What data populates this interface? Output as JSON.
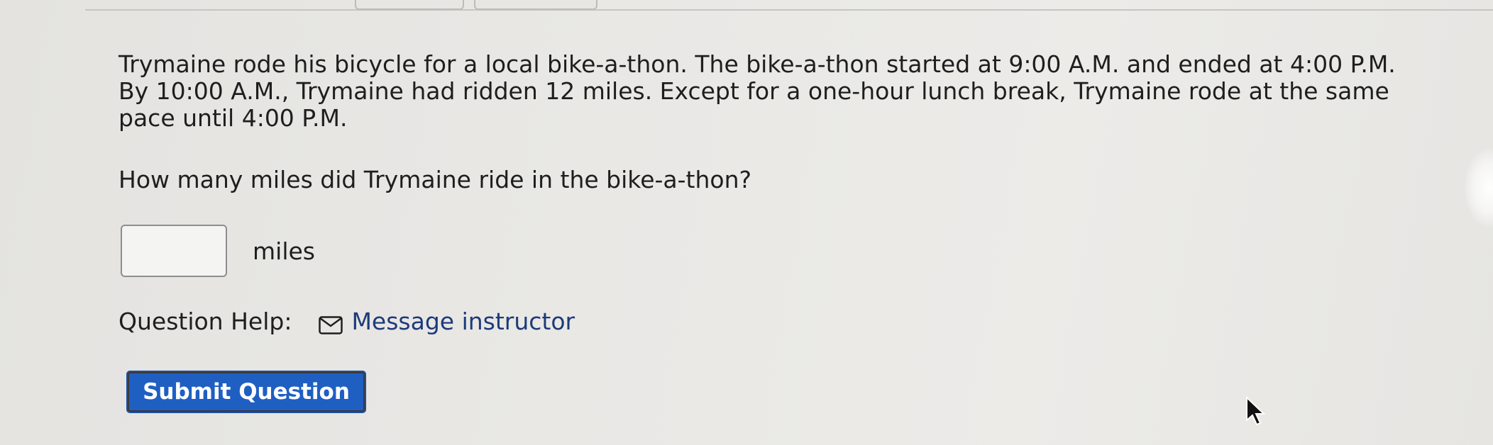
{
  "question": {
    "text": "Trymaine rode his bicycle for a local bike-a-thon. The bike-a-thon started at 9:00 A.M. and ended at 4:00 P.M. By 10:00 A.M., Trymaine had ridden 12 miles. Except for a one-hour lunch break, Trymaine rode at the same pace until 4:00 P.M.",
    "prompt": "How many miles did Trymaine ride in the bike-a-thon?"
  },
  "answer": {
    "value": "",
    "units": "miles"
  },
  "help": {
    "label": "Question Help:",
    "icon": "mail-icon",
    "link_label": "Message instructor"
  },
  "submit": {
    "label": "Submit Question",
    "color": "#1f5fc2"
  }
}
